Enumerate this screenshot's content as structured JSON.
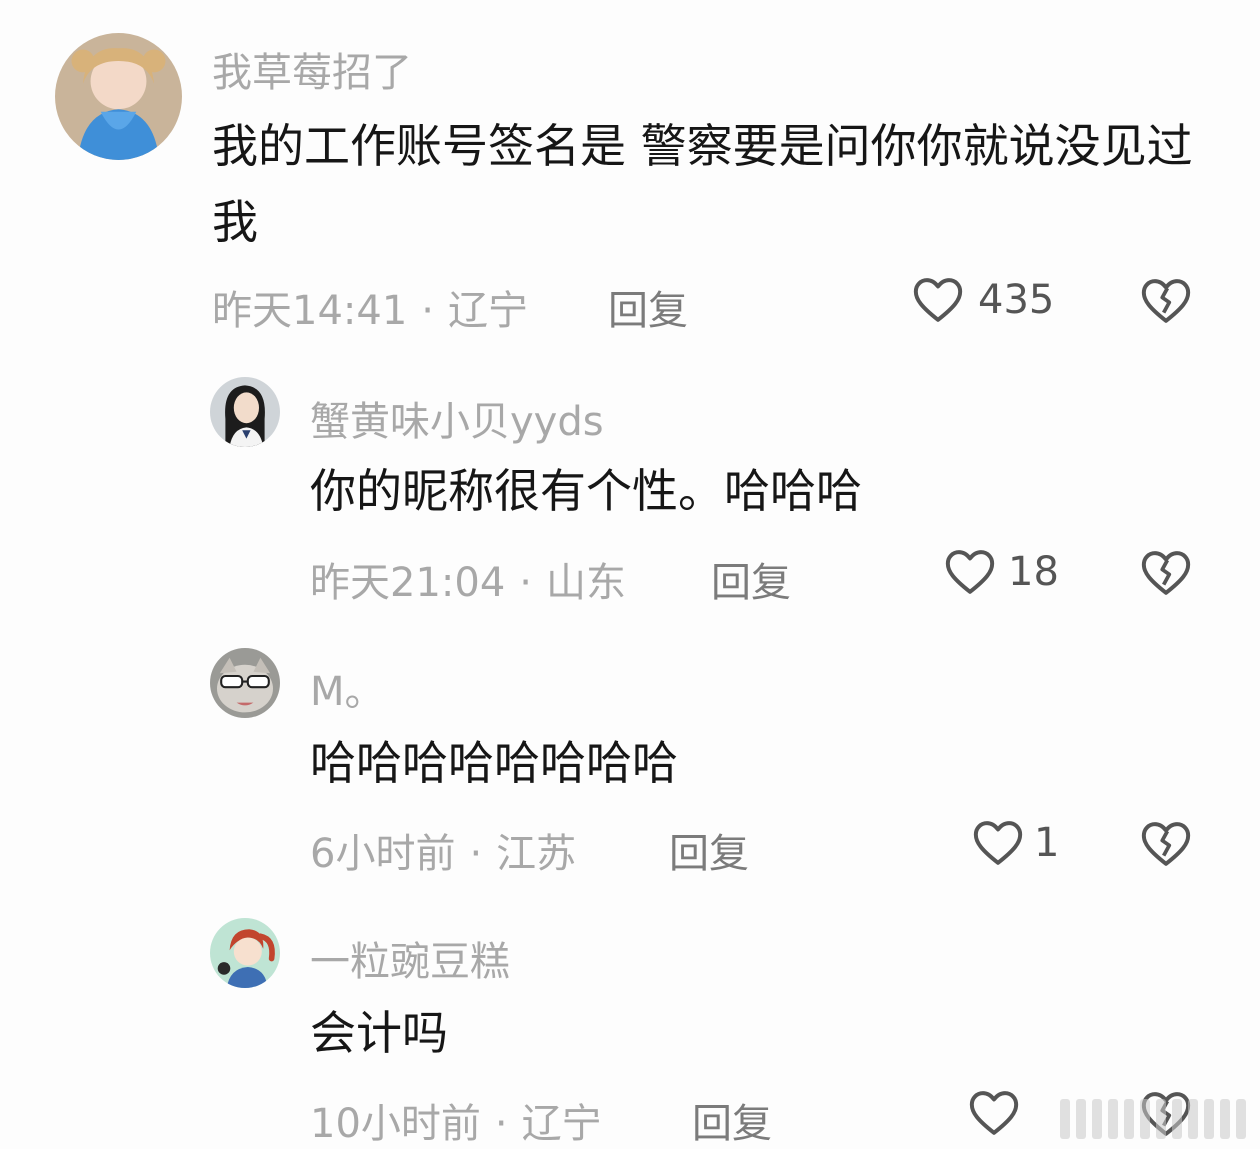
{
  "comments": [
    {
      "username": "我草莓招了",
      "content": "我的工作账号签名是 警察要是问你你就说没见过我",
      "time": "昨天14:41",
      "location": "辽宁",
      "reply_label": "回复",
      "likes": "435",
      "avatar_icon": "avatar-girl-blue-sweater"
    },
    {
      "username": "蟹黄味小贝yyds",
      "content": "你的昵称很有个性。哈哈哈",
      "time": "昨天21:04",
      "location": "山东",
      "reply_label": "回复",
      "likes": "18",
      "avatar_icon": "avatar-girl-dark-hair"
    },
    {
      "username": "M。",
      "content": "哈哈哈哈哈哈哈哈",
      "time": "6小时前",
      "location": "江苏",
      "reply_label": "回复",
      "likes": "1",
      "avatar_icon": "avatar-cat-sunglasses"
    },
    {
      "username": "一粒豌豆糕",
      "content": "会计吗",
      "time": "10小时前",
      "location": "辽宁",
      "reply_label": "回复",
      "likes": "",
      "avatar_icon": "avatar-cartoon-girl"
    }
  ],
  "separator": "·",
  "icons": {
    "like": "heart-outline-icon",
    "dislike": "broken-heart-icon"
  },
  "colors": {
    "background": "#fdfdfd",
    "text_primary": "#161616",
    "text_secondary": "#a8a8a8"
  }
}
